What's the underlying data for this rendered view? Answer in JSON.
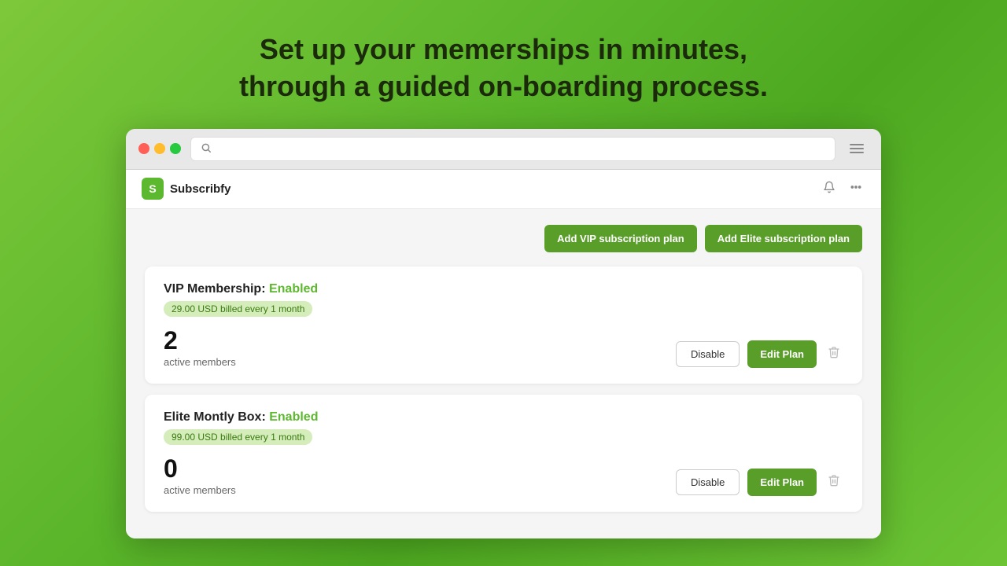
{
  "hero": {
    "line1": "Set up your memerships in minutes,",
    "line2": "through a guided on-boarding process."
  },
  "browser": {
    "search_placeholder": ""
  },
  "navbar": {
    "brand_initial": "S",
    "brand_name": "Subscribfy"
  },
  "action_bar": {
    "btn_vip_label": "Add VIP subscription plan",
    "btn_elite_label": "Add Elite subscription plan"
  },
  "plans": [
    {
      "id": "vip",
      "title": "VIP Membership:",
      "status": "Enabled",
      "badge": "29.00 USD billed every 1 month",
      "member_count": "2",
      "member_label": "active members",
      "disable_label": "Disable",
      "edit_label": "Edit Plan"
    },
    {
      "id": "elite",
      "title": "Elite Montly Box:",
      "status": "Enabled",
      "badge": "99.00 USD billed every 1 month",
      "member_count": "0",
      "member_label": "active members",
      "disable_label": "Disable",
      "edit_label": "Edit Plan"
    }
  ]
}
